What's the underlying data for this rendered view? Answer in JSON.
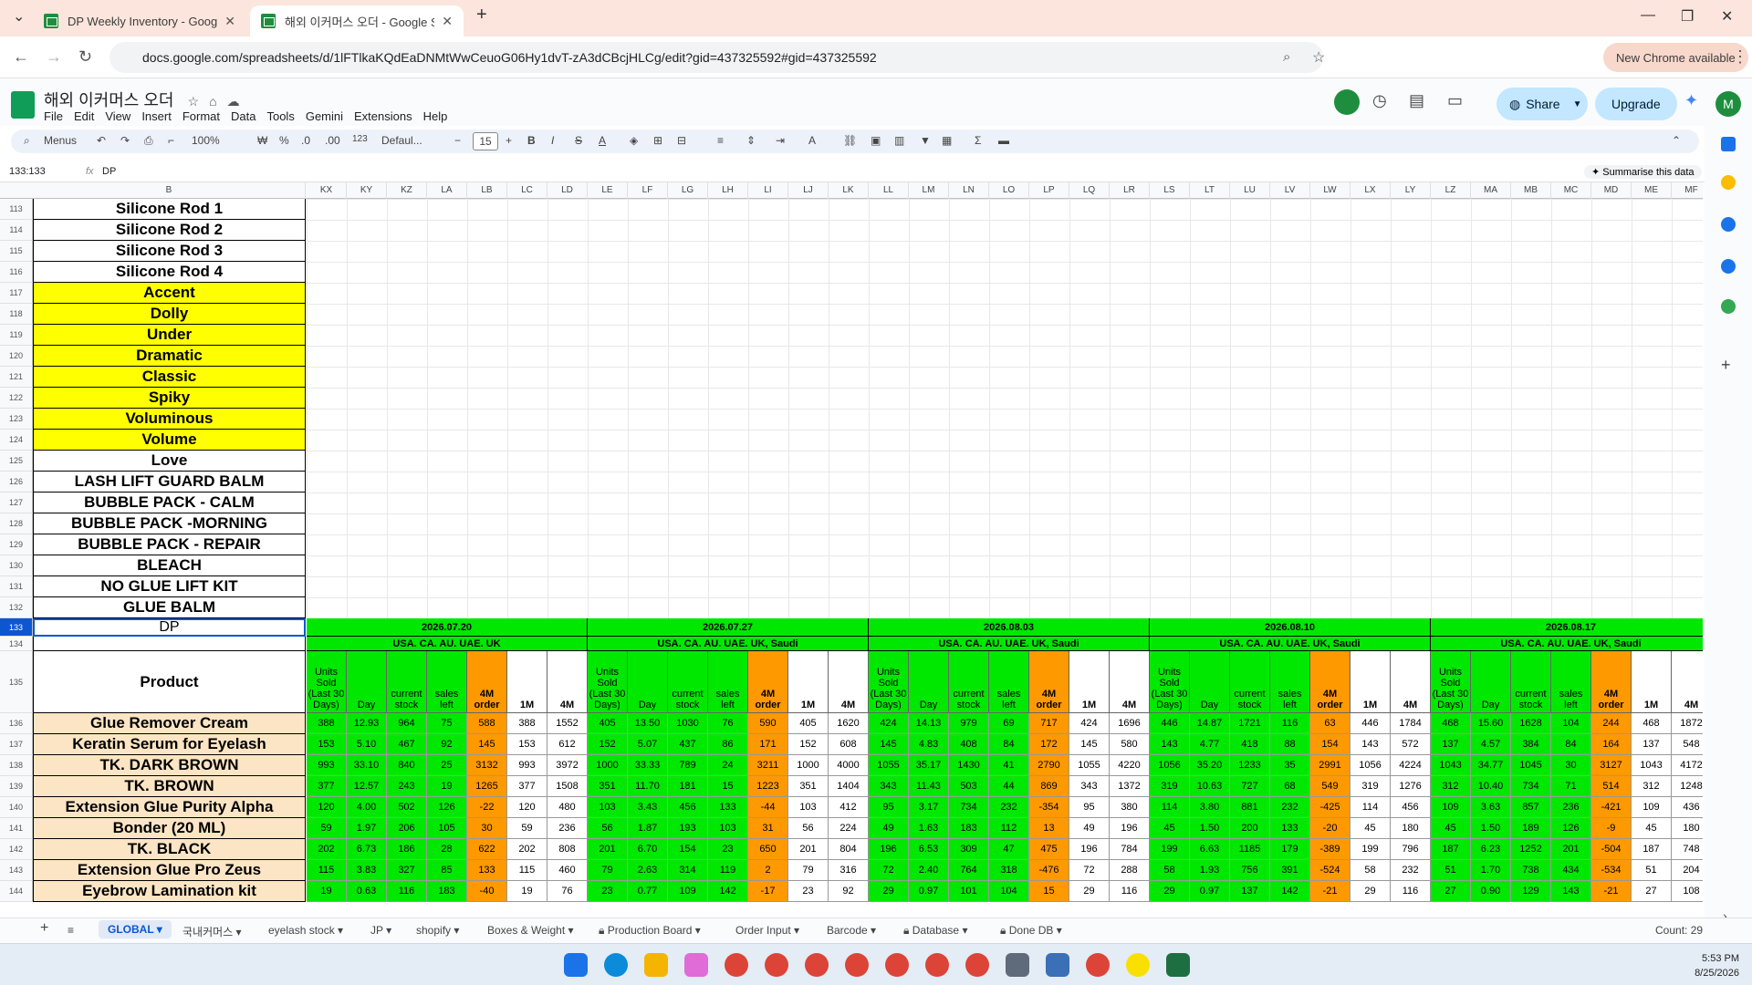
{
  "browser": {
    "tabs": [
      {
        "title": "DP Weekly Inventory - Google S"
      },
      {
        "title": "해외 이커머스 오더 - Google Sh"
      }
    ],
    "url": "docs.google.com/spreadsheets/d/1lFTlkaKQdEaDNMtWwCeuoG06Hy1dvT-zA3dCBcjHLCg/edit?gid=437325592#gid=437325592",
    "new_chrome": "New Chrome available",
    "profile_initial": "M"
  },
  "sheets": {
    "doc_title": "해외 이커머스 오더",
    "menu": [
      "File",
      "Edit",
      "View",
      "Insert",
      "Format",
      "Data",
      "Tools",
      "Gemini",
      "Extensions",
      "Help"
    ],
    "share_label": "Share",
    "upgrade_label": "Upgrade",
    "user_initial": "M"
  },
  "toolbar": {
    "menus": "Menus",
    "zoom": "100%",
    "currency": "₩",
    "percent": "%",
    "dec_less": ".0",
    "dec_more": ".00",
    "num_format": "123",
    "font": "Defaul...",
    "font_size": "15"
  },
  "formula_bar": {
    "name_box": "133:133",
    "fx": "fx",
    "value": "DP",
    "summarise": "Summarise this data"
  },
  "columns": [
    "KX",
    "KY",
    "KZ",
    "LA",
    "LB",
    "LC",
    "LD",
    "LE",
    "LF",
    "LG",
    "LH",
    "LI",
    "LJ",
    "LK",
    "LL",
    "LM",
    "LN",
    "LO",
    "LP",
    "LQ",
    "LR",
    "LS",
    "LT",
    "LU",
    "LV",
    "LW",
    "LX",
    "LY",
    "LZ",
    "MA",
    "MB",
    "MC",
    "MD",
    "ME",
    "MF"
  ],
  "col_b_label": "B",
  "top_rows": [
    {
      "n": "113",
      "label": "Silicone Rod 1",
      "bg": "#ffffff"
    },
    {
      "n": "114",
      "label": "Silicone Rod 2",
      "bg": "#ffffff"
    },
    {
      "n": "115",
      "label": "Silicone Rod 3",
      "bg": "#ffffff"
    },
    {
      "n": "116",
      "label": "Silicone Rod 4",
      "bg": "#ffffff"
    },
    {
      "n": "117",
      "label": "Accent",
      "bg": "#ffff00"
    },
    {
      "n": "118",
      "label": "Dolly",
      "bg": "#ffff00"
    },
    {
      "n": "119",
      "label": "Under",
      "bg": "#ffff00"
    },
    {
      "n": "120",
      "label": "Dramatic",
      "bg": "#ffff00"
    },
    {
      "n": "121",
      "label": "Classic",
      "bg": "#ffff00"
    },
    {
      "n": "122",
      "label": "Spiky",
      "bg": "#ffff00"
    },
    {
      "n": "123",
      "label": "Voluminous",
      "bg": "#ffff00"
    },
    {
      "n": "124",
      "label": "Volume",
      "bg": "#ffff00"
    },
    {
      "n": "125",
      "label": "Love",
      "bg": "#ffffff"
    },
    {
      "n": "126",
      "label": "LASH LIFT GUARD BALM",
      "bg": "#ffffff"
    },
    {
      "n": "127",
      "label": "BUBBLE PACK - CALM",
      "bg": "#ffffff"
    },
    {
      "n": "128",
      "label": "BUBBLE PACK -MORNING",
      "bg": "#ffffff"
    },
    {
      "n": "129",
      "label": "BUBBLE PACK - REPAIR",
      "bg": "#ffffff"
    },
    {
      "n": "130",
      "label": "BLEACH",
      "bg": "#ffffff"
    },
    {
      "n": "131",
      "label": "NO GLUE LIFT KIT",
      "bg": "#ffffff"
    },
    {
      "n": "132",
      "label": "GLUE BALM",
      "bg": "#ffffff"
    }
  ],
  "row133": {
    "n": "133",
    "label": "DP"
  },
  "row134": {
    "n": "134"
  },
  "row135": {
    "n": "135",
    "label": "Product"
  },
  "weeks": [
    {
      "date": "2026.07.20",
      "markets": "USA. CA. AU. UAE. UK"
    },
    {
      "date": "2026.07.27",
      "markets": "USA. CA. AU. UAE. UK, Saudi"
    },
    {
      "date": "2026.08.03",
      "markets": "USA. CA. AU. UAE. UK, Saudi"
    },
    {
      "date": "2026.08.10",
      "markets": "USA. CA. AU. UAE. UK, Saudi"
    },
    {
      "date": "2026.08.17",
      "markets": "USA. CA. AU. UAE. UK, Saudi"
    }
  ],
  "week_headers": [
    "Units Sold (Last 30 Days)",
    "Day",
    "current stock",
    "sales left",
    "4M order",
    "1M",
    "4M"
  ],
  "products": [
    {
      "n": "136",
      "name": "Glue Remover Cream",
      "vals": [
        "388",
        "12.93",
        "964",
        "75",
        "588",
        "388",
        "1552",
        "405",
        "13.50",
        "1030",
        "76",
        "590",
        "405",
        "1620",
        "424",
        "14.13",
        "979",
        "69",
        "717",
        "424",
        "1696",
        "446",
        "14.87",
        "1721",
        "116",
        "63",
        "446",
        "1784",
        "468",
        "15.60",
        "1628",
        "104",
        "244",
        "468",
        "1872"
      ]
    },
    {
      "n": "137",
      "name": "Keratin Serum for Eyelash",
      "vals": [
        "153",
        "5.10",
        "467",
        "92",
        "145",
        "153",
        "612",
        "152",
        "5.07",
        "437",
        "86",
        "171",
        "152",
        "608",
        "145",
        "4.83",
        "408",
        "84",
        "172",
        "145",
        "580",
        "143",
        "4.77",
        "418",
        "88",
        "154",
        "143",
        "572",
        "137",
        "4.57",
        "384",
        "84",
        "164",
        "137",
        "548"
      ]
    },
    {
      "n": "138",
      "name": "TK. DARK BROWN",
      "vals": [
        "993",
        "33.10",
        "840",
        "25",
        "3132",
        "993",
        "3972",
        "1000",
        "33.33",
        "789",
        "24",
        "3211",
        "1000",
        "4000",
        "1055",
        "35.17",
        "1430",
        "41",
        "2790",
        "1055",
        "4220",
        "1056",
        "35.20",
        "1233",
        "35",
        "2991",
        "1056",
        "4224",
        "1043",
        "34.77",
        "1045",
        "30",
        "3127",
        "1043",
        "4172"
      ]
    },
    {
      "n": "139",
      "name": "TK. BROWN",
      "vals": [
        "377",
        "12.57",
        "243",
        "19",
        "1265",
        "377",
        "1508",
        "351",
        "11.70",
        "181",
        "15",
        "1223",
        "351",
        "1404",
        "343",
        "11.43",
        "503",
        "44",
        "869",
        "343",
        "1372",
        "319",
        "10.63",
        "727",
        "68",
        "549",
        "319",
        "1276",
        "312",
        "10.40",
        "734",
        "71",
        "514",
        "312",
        "1248"
      ]
    },
    {
      "n": "140",
      "name": "Extension Glue Purity Alpha",
      "vals": [
        "120",
        "4.00",
        "502",
        "126",
        "-22",
        "120",
        "480",
        "103",
        "3.43",
        "456",
        "133",
        "-44",
        "103",
        "412",
        "95",
        "3.17",
        "734",
        "232",
        "-354",
        "95",
        "380",
        "114",
        "3.80",
        "881",
        "232",
        "-425",
        "114",
        "456",
        "109",
        "3.63",
        "857",
        "236",
        "-421",
        "109",
        "436"
      ]
    },
    {
      "n": "141",
      "name": "Bonder (20 ML)",
      "vals": [
        "59",
        "1.97",
        "206",
        "105",
        "30",
        "59",
        "236",
        "56",
        "1.87",
        "193",
        "103",
        "31",
        "56",
        "224",
        "49",
        "1.63",
        "183",
        "112",
        "13",
        "49",
        "196",
        "45",
        "1.50",
        "200",
        "133",
        "-20",
        "45",
        "180",
        "45",
        "1.50",
        "189",
        "126",
        "-9",
        "45",
        "180"
      ]
    },
    {
      "n": "142",
      "name": "TK. BLACK",
      "vals": [
        "202",
        "6.73",
        "186",
        "28",
        "622",
        "202",
        "808",
        "201",
        "6.70",
        "154",
        "23",
        "650",
        "201",
        "804",
        "196",
        "6.53",
        "309",
        "47",
        "475",
        "196",
        "784",
        "199",
        "6.63",
        "1185",
        "179",
        "-389",
        "199",
        "796",
        "187",
        "6.23",
        "1252",
        "201",
        "-504",
        "187",
        "748"
      ]
    },
    {
      "n": "143",
      "name": "Extension Glue Pro Zeus",
      "vals": [
        "115",
        "3.83",
        "327",
        "85",
        "133",
        "115",
        "460",
        "79",
        "2.63",
        "314",
        "119",
        "2",
        "79",
        "316",
        "72",
        "2.40",
        "764",
        "318",
        "-476",
        "72",
        "288",
        "58",
        "1.93",
        "756",
        "391",
        "-524",
        "58",
        "232",
        "51",
        "1.70",
        "738",
        "434",
        "-534",
        "51",
        "204"
      ]
    },
    {
      "n": "144",
      "name": "Eyebrow Lamination kit",
      "vals": [
        "19",
        "0.63",
        "116",
        "183",
        "-40",
        "19",
        "76",
        "23",
        "0.77",
        "109",
        "142",
        "-17",
        "23",
        "92",
        "29",
        "0.97",
        "101",
        "104",
        "15",
        "29",
        "116",
        "29",
        "0.97",
        "137",
        "142",
        "-21",
        "29",
        "116",
        "27",
        "0.90",
        "129",
        "143",
        "-21",
        "27",
        "108"
      ]
    }
  ],
  "sheet_tabs": [
    {
      "label": "GLOBAL",
      "active": true
    },
    {
      "label": "국내커머스"
    },
    {
      "label": "eyelash stock"
    },
    {
      "label": "JP"
    },
    {
      "label": "shopify"
    },
    {
      "label": "Boxes & Weight"
    },
    {
      "label": "Production Board",
      "locked": true
    },
    {
      "label": "Order Input"
    },
    {
      "label": "Barcode"
    },
    {
      "label": "Database",
      "locked": true
    },
    {
      "label": "Done DB",
      "locked": true
    }
  ],
  "count": "Count: 29",
  "taskbar": {
    "time": "5:53 PM",
    "date": "8/25/2026"
  },
  "colors": {
    "green": "#00e800",
    "orange": "#ff9900",
    "product_bg": "#fce5c4",
    "yellow": "#ffff00",
    "accent_blue": "#0b57d0"
  }
}
